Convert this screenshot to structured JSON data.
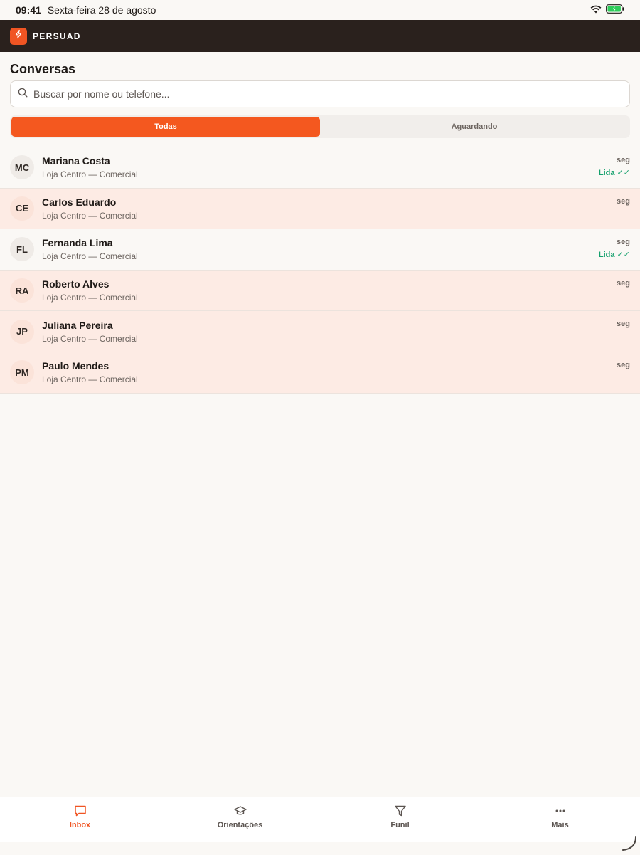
{
  "status_bar": {
    "time": "09:41",
    "date": "Sexta-feira 28 de agosto",
    "icons": [
      "wifi-icon",
      "battery-charging-icon"
    ]
  },
  "header": {
    "brand": "PERSUAD",
    "logo_icon": "lightning-bolt-icon",
    "colors": {
      "header_bg": "#2a211d",
      "accent": "#f05523"
    }
  },
  "page": {
    "title": "Conversas"
  },
  "search": {
    "placeholder": "Buscar por nome ou telefone...",
    "icon": "search-icon"
  },
  "tabs": [
    {
      "label": "Todas",
      "active": true
    },
    {
      "label": "Aguardando",
      "active": false
    }
  ],
  "conversations": [
    {
      "initials": "MC",
      "name": "Mariana Costa",
      "subtitle": "Loja Centro — Comercial",
      "time": "seg",
      "status": "Lida ✓✓",
      "unread": false
    },
    {
      "initials": "CE",
      "name": "Carlos Eduardo",
      "subtitle": "Loja Centro — Comercial",
      "time": "seg",
      "status": "",
      "unread": true
    },
    {
      "initials": "FL",
      "name": "Fernanda Lima",
      "subtitle": "Loja Centro — Comercial",
      "time": "seg",
      "status": "Lida ✓✓",
      "unread": false
    },
    {
      "initials": "RA",
      "name": "Roberto Alves",
      "subtitle": "Loja Centro — Comercial",
      "time": "seg",
      "status": "",
      "unread": true
    },
    {
      "initials": "JP",
      "name": "Juliana Pereira",
      "subtitle": "Loja Centro — Comercial",
      "time": "seg",
      "status": "",
      "unread": true
    },
    {
      "initials": "PM",
      "name": "Paulo Mendes",
      "subtitle": "Loja Centro — Comercial",
      "time": "seg",
      "status": "",
      "unread": true
    }
  ],
  "bottom_nav": [
    {
      "label": "Inbox",
      "icon": "chat-bubble-icon",
      "active": true
    },
    {
      "label": "Orientações",
      "icon": "graduation-cap-icon",
      "active": false
    },
    {
      "label": "Funil",
      "icon": "funnel-icon",
      "active": false
    },
    {
      "label": "Mais",
      "icon": "more-dots-icon",
      "active": false
    }
  ]
}
